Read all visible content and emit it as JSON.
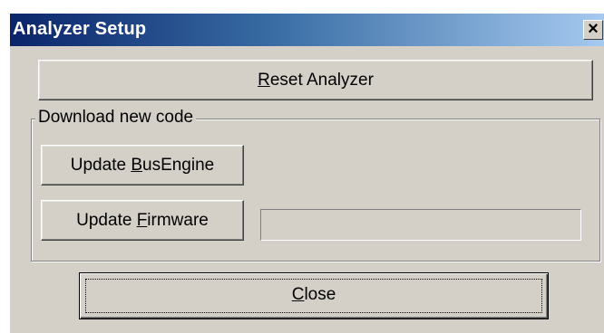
{
  "window": {
    "title": "Analyzer Setup",
    "close_glyph": "✕",
    "colors": {
      "titlebar_start": "#0a246a",
      "titlebar_end": "#a6caf0",
      "face": "#d4d0c8"
    }
  },
  "buttons": {
    "reset": {
      "mnemonic": "R",
      "rest": "eset Analyzer"
    },
    "update_busengine": {
      "pre": "Update ",
      "mnemonic": "B",
      "rest": "usEngine"
    },
    "update_firmware": {
      "pre": "Update ",
      "mnemonic": "F",
      "rest": "irmware"
    },
    "close": {
      "mnemonic": "C",
      "rest": "lose"
    }
  },
  "group": {
    "label": "Download new code"
  },
  "progress": {
    "value": 0
  },
  "icons": {
    "close": "close-icon"
  }
}
